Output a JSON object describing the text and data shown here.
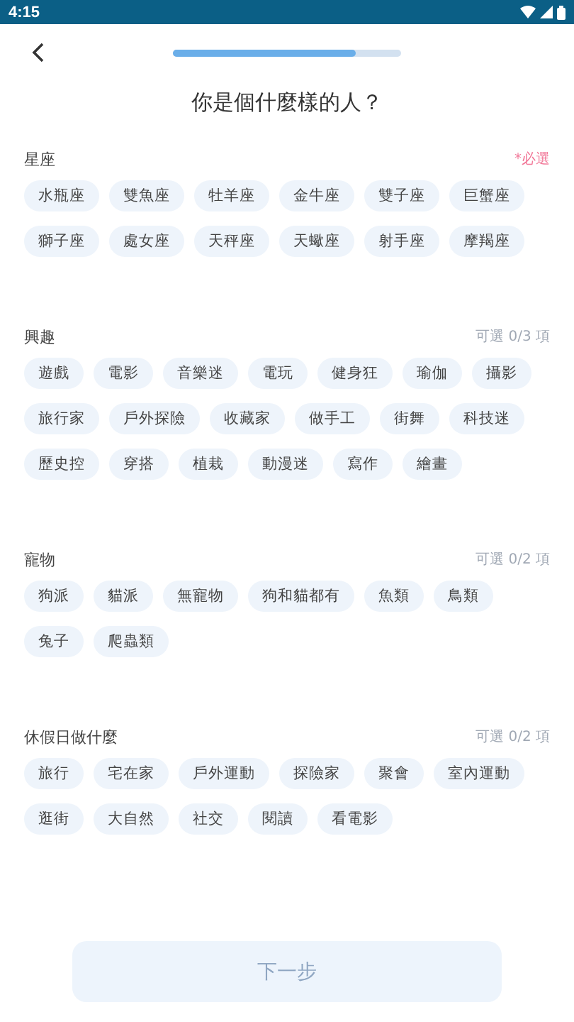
{
  "status_bar": {
    "time": "4:15"
  },
  "header": {
    "progress": {
      "level": 0.8
    }
  },
  "title": "你是個什麼樣的人？",
  "sections": [
    {
      "title": "星座",
      "note": "*必選",
      "kind": "required",
      "options": [
        {
          "label": "水瓶座",
          "selected": false
        },
        {
          "label": "雙魚座",
          "selected": false
        },
        {
          "label": "牡羊座",
          "selected": false
        },
        {
          "label": "金牛座",
          "selected": false
        },
        {
          "label": "雙子座",
          "selected": false
        },
        {
          "label": "巨蟹座",
          "selected": false
        },
        {
          "label": "獅子座",
          "selected": false
        },
        {
          "label": "處女座",
          "selected": false
        },
        {
          "label": "天秤座",
          "selected": false
        },
        {
          "label": "天蠍座",
          "selected": false
        },
        {
          "label": "射手座",
          "selected": false
        },
        {
          "label": "摩羯座",
          "selected": false
        }
      ]
    },
    {
      "title": "興趣",
      "note": "可選 0/3 項",
      "kind": "optional",
      "options": [
        {
          "label": "遊戲",
          "selected": false
        },
        {
          "label": "電影",
          "selected": false
        },
        {
          "label": "音樂迷",
          "selected": false
        },
        {
          "label": "電玩",
          "selected": false
        },
        {
          "label": "健身狂",
          "selected": false
        },
        {
          "label": "瑜伽",
          "selected": false
        },
        {
          "label": "攝影",
          "selected": false
        },
        {
          "label": "旅行家",
          "selected": false
        },
        {
          "label": "戶外探險",
          "selected": false
        },
        {
          "label": "收藏家",
          "selected": false
        },
        {
          "label": "做手工",
          "selected": false
        },
        {
          "label": "街舞",
          "selected": false
        },
        {
          "label": "科技迷",
          "selected": false
        },
        {
          "label": "歷史控",
          "selected": false
        },
        {
          "label": "穿搭",
          "selected": false
        },
        {
          "label": "植栽",
          "selected": false
        },
        {
          "label": "動漫迷",
          "selected": false
        },
        {
          "label": "寫作",
          "selected": false
        },
        {
          "label": "繪畫",
          "selected": false
        }
      ]
    },
    {
      "title": "寵物",
      "note": "可選 0/2 項",
      "kind": "optional",
      "options": [
        {
          "label": "狗派",
          "selected": false
        },
        {
          "label": "貓派",
          "selected": false
        },
        {
          "label": "無寵物",
          "selected": false
        },
        {
          "label": "狗和貓都有",
          "selected": false
        },
        {
          "label": "魚類",
          "selected": false
        },
        {
          "label": "鳥類",
          "selected": false
        },
        {
          "label": "兔子",
          "selected": false
        },
        {
          "label": "爬蟲類",
          "selected": false
        }
      ]
    },
    {
      "title": "休假日做什麼",
      "note": "可選 0/2 項",
      "kind": "optional",
      "options": [
        {
          "label": "旅行",
          "selected": false
        },
        {
          "label": "宅在家",
          "selected": false
        },
        {
          "label": "戶外運動",
          "selected": false
        },
        {
          "label": "探險家",
          "selected": false
        },
        {
          "label": "聚會",
          "selected": false
        },
        {
          "label": "室內運動",
          "selected": false
        },
        {
          "label": "逛街",
          "selected": false
        },
        {
          "label": "大自然",
          "selected": false
        },
        {
          "label": "社交",
          "selected": false
        },
        {
          "label": "閱讀",
          "selected": false
        },
        {
          "label": "看電影",
          "selected": false
        }
      ]
    }
  ],
  "next_button": {
    "label": "下一步",
    "disabled": true
  }
}
